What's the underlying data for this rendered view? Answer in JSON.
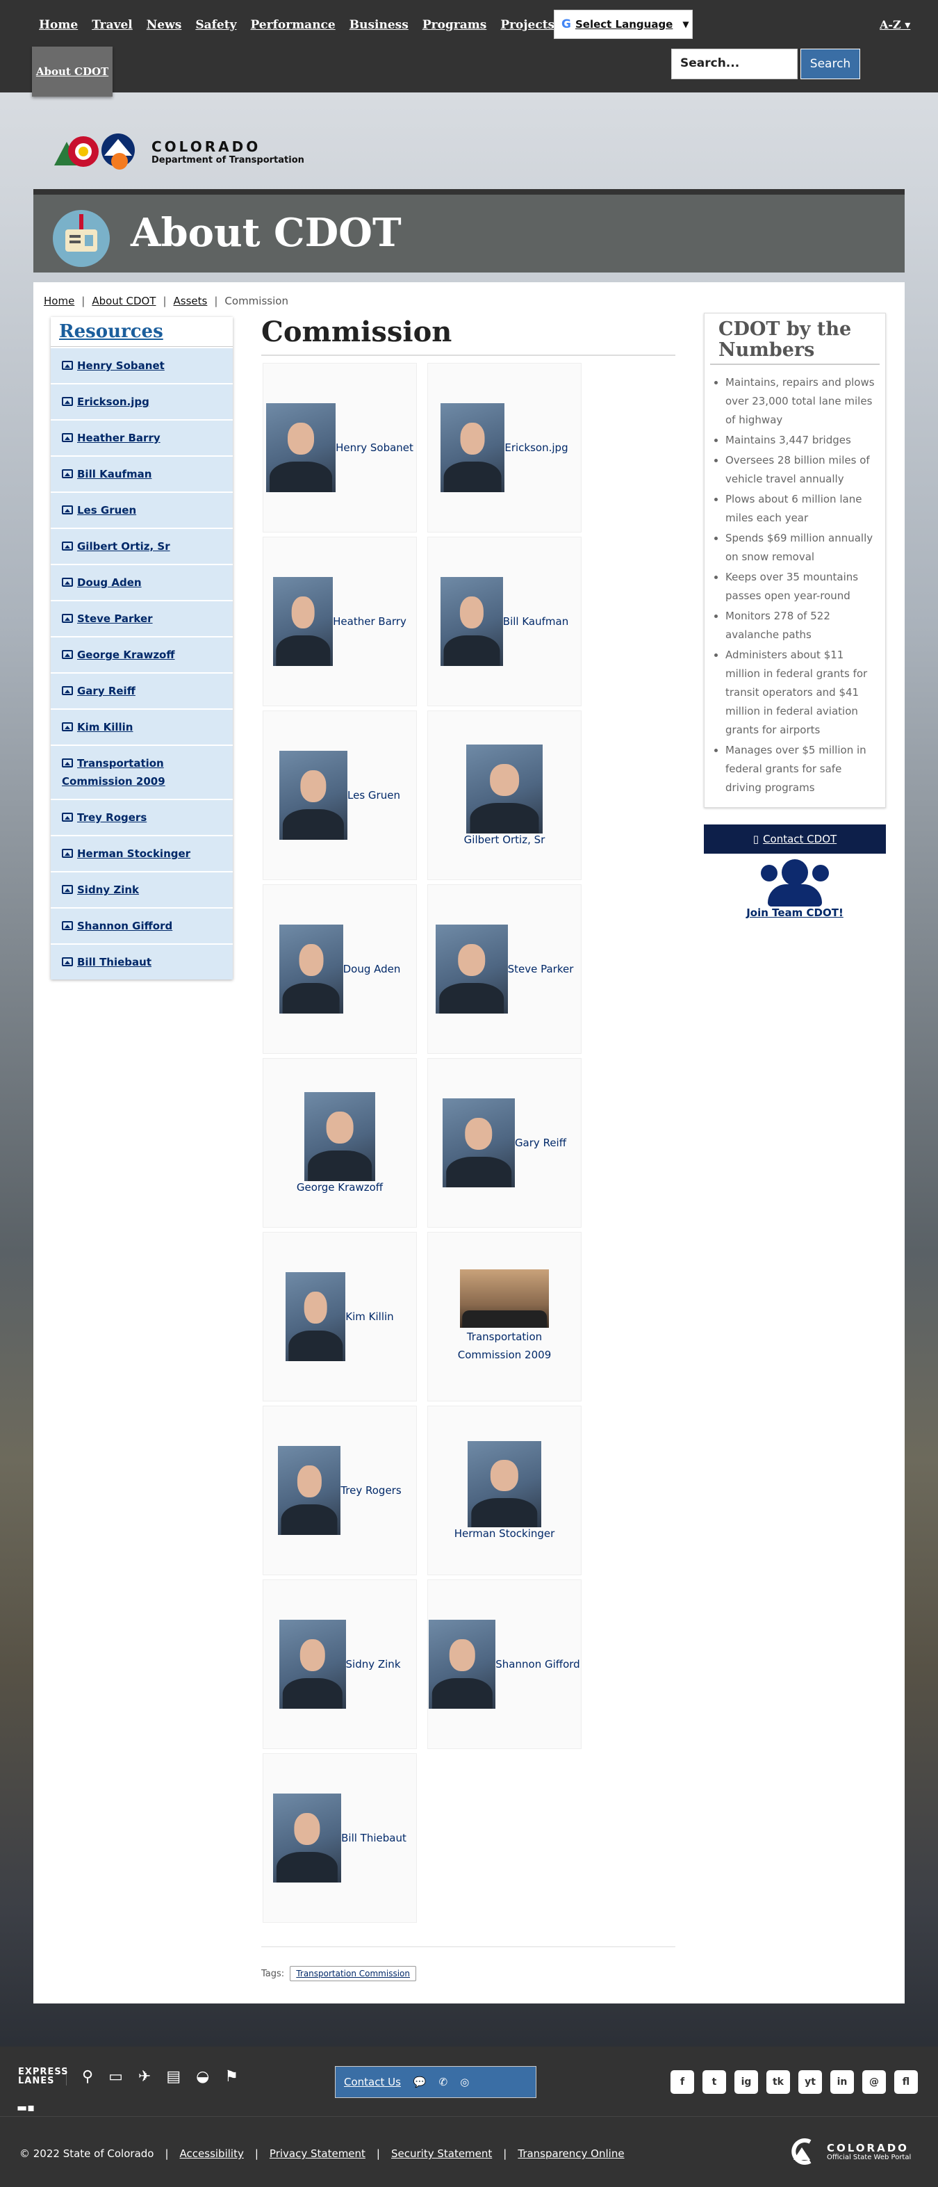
{
  "nav": {
    "links": [
      "Home",
      "Travel",
      "News",
      "Safety",
      "Performance",
      "Business",
      "Programs",
      "Projects"
    ],
    "language": "Select Language",
    "az": "A-Z",
    "about": "About CDOT",
    "search_placeholder": "Search...",
    "search_button": "Search"
  },
  "logo": {
    "line1": "COLORADO",
    "line2": "Department of Transportation"
  },
  "banner": {
    "title": "About CDOT"
  },
  "breadcrumb": {
    "items": [
      "Home",
      "About CDOT",
      "Assets"
    ],
    "current": "Commission"
  },
  "sidebar": {
    "title": "Resources",
    "items": [
      "Henry Sobanet",
      "Erickson.jpg",
      "Heather Barry",
      "Bill Kaufman",
      "Les Gruen",
      "Gilbert Ortiz, Sr",
      "Doug Aden",
      "Steve Parker",
      "George Krawzoff",
      "Gary Reiff",
      "Kim Killin",
      "Transportation Commission 2009",
      "Trey Rogers",
      "Herman Stockinger",
      "Sidny Zink",
      "Shannon Gifford",
      "Bill Thiebaut"
    ]
  },
  "content": {
    "title": "Commission",
    "gallery": [
      "Henry Sobanet",
      "Erickson.jpg",
      "Heather Barry",
      "Bill Kaufman",
      "Les Gruen",
      "Gilbert Ortiz, Sr",
      "Doug Aden",
      "Steve Parker",
      "George Krawzoff",
      "Gary Reiff",
      "Kim Killin",
      "Transportation Commission 2009",
      "Trey Rogers",
      "Herman Stockinger",
      "Sidny Zink",
      "Shannon Gifford",
      "Bill Thiebaut"
    ],
    "tags_label": "Tags:",
    "tag": "Transportation Commission"
  },
  "numbers": {
    "title": "CDOT by the Numbers",
    "items": [
      "Maintains, repairs and plows over 23,000 total lane miles of highway",
      "Maintains 3,447 bridges",
      "Oversees 28 billion miles of vehicle travel annually",
      "Plows about 6 million lane miles each year",
      "Spends $69 million annually on snow removal",
      "Keeps over 35 mountains passes open year-round",
      "Monitors 278 of 522 avalanche paths",
      "Administers about $11 million in federal grants for transit operators and $41 million in federal aviation grants for airports",
      "Manages over $5 million in federal grants for safe driving programs"
    ],
    "contact": "Contact CDOT",
    "join": "Join Team CDOT!"
  },
  "footer": {
    "express": "EXPRESS LANES",
    "contact_us": "Contact Us",
    "social": [
      "f",
      "t",
      "ig",
      "tk",
      "yt",
      "in",
      "@",
      "fl"
    ],
    "copyright": "© 2022 State of Colorado",
    "links": [
      "Accessibility",
      "Privacy Statement",
      "Security Statement",
      "Transparency Online"
    ],
    "logo_line1": "COLORADO",
    "logo_line2": "Official State Web Portal"
  }
}
